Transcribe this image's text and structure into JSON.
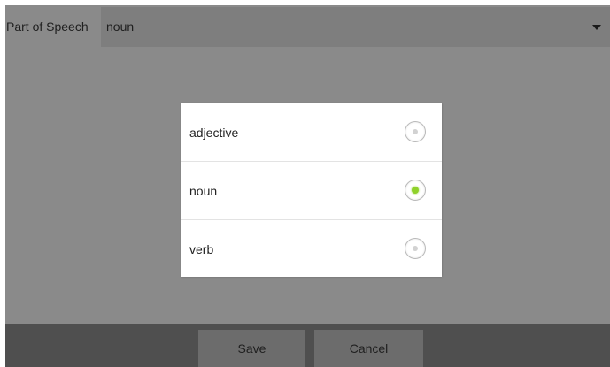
{
  "part_of_speech": {
    "label": "Part of Speech",
    "selected_value": "noun",
    "caret_icon": "dropdown-triangle-icon"
  },
  "dialog": {
    "options": [
      {
        "label": "adjective",
        "checked": false
      },
      {
        "label": "noun",
        "checked": true
      },
      {
        "label": "verb",
        "checked": false
      }
    ],
    "accent_color": "#8fd12a"
  },
  "bottom_bar": {
    "save_label": "Save",
    "cancel_label": "Cancel"
  }
}
